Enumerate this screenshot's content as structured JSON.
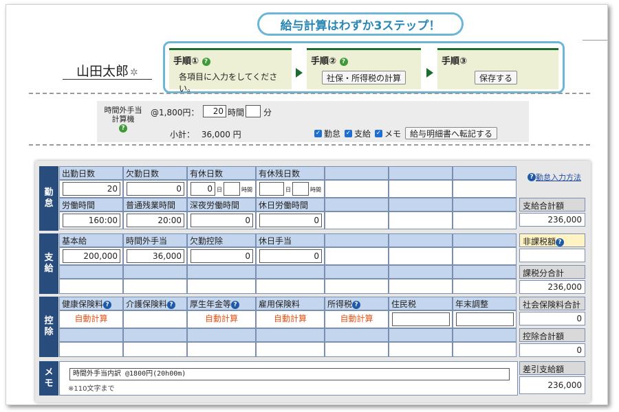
{
  "employee": {
    "name": "山田太郎"
  },
  "banner": {
    "text": "給与計算はわずか3ステップ！"
  },
  "steps": [
    {
      "title": "手順①",
      "desc": "各項目に入力をしてください。"
    },
    {
      "title": "手順②",
      "button": "社保・所得税の計算"
    },
    {
      "title": "手順③",
      "button": "保存する"
    }
  ],
  "overtime": {
    "label1": "時間外手当",
    "label2": "計算機",
    "rate_text": "@1,800円：",
    "hours_value": "20",
    "hours_unit": "時間",
    "minutes_value": "",
    "minutes_unit": "分",
    "subtotal_label": "小計：",
    "subtotal_value": "36,000 円",
    "checks": [
      "勤怠",
      "支給",
      "メモ"
    ],
    "transfer_button": "給与明細書へ転記する"
  },
  "sections": {
    "attendance": "勤\n怠",
    "payment": "支\n給",
    "deduction": "控\n除",
    "memo": "メ\nモ"
  },
  "attendance": {
    "headers1": [
      "出勤日数",
      "欠勤日数",
      "有休日数",
      "有休残日数"
    ],
    "values1": [
      "20",
      "0",
      "0",
      ""
    ],
    "day_unit": "日",
    "hour_unit": "時間",
    "headers2": [
      "労働時間",
      "普通残業時間",
      "深夜労働時間",
      "休日労働時間"
    ],
    "values2": [
      "160:00",
      "20:00",
      "0",
      "0"
    ]
  },
  "payment": {
    "headers": [
      "基本給",
      "時間外手当",
      "欠勤控除",
      "休日手当"
    ],
    "values": [
      "200,000",
      "36,000",
      "0",
      "0"
    ]
  },
  "deduction": {
    "headers": [
      "健康保険料",
      "介護保険料",
      "厚生年金等",
      "雇用保険料",
      "所得税",
      "住民税",
      "年末調整"
    ],
    "auto_text": "自動計算"
  },
  "memo": {
    "value": "時間外手当内訳 @1800円(20h00m)",
    "note": "※110文字まで"
  },
  "right_panel": {
    "help_link": "勤怠入力方法",
    "total_pay_label": "支給合計額",
    "total_pay": "236,000",
    "nontax_label": "非課税額",
    "nontax_value": "",
    "taxable_label": "課税分合計",
    "taxable_value": "236,000",
    "social_label": "社会保険料合計",
    "social_value": "0",
    "deduct_label": "控除合計額",
    "deduct_value": "0",
    "net_label": "差引支給額",
    "net_value": "236,000"
  },
  "colors": {
    "accent_blue": "#6bb6d6",
    "step_green": "#1d6b2e",
    "section_navy": "#284c7c",
    "header_blue": "#c4d6ee",
    "auto_orange": "#e2541a"
  }
}
